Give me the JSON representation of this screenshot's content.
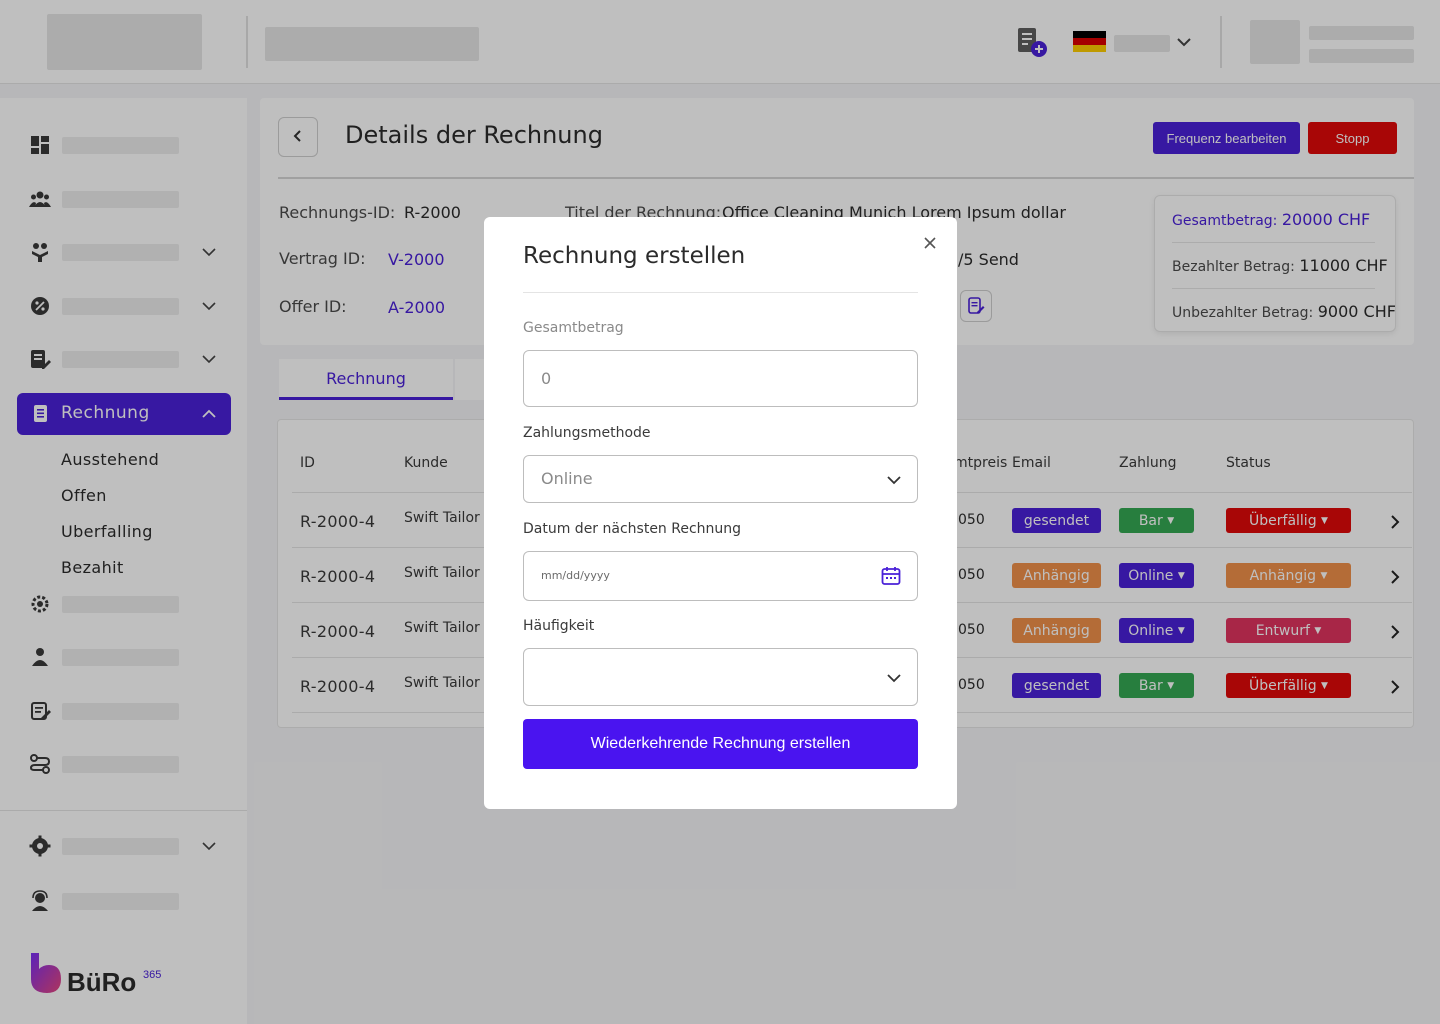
{
  "colors": {
    "accent": "#4a21d8",
    "danger": "#e10909",
    "success": "#34a853",
    "warning": "#f0914a",
    "draft": "#e0335f"
  },
  "sidebar": {
    "active_label": "Rechnung",
    "sub_items": [
      "Ausstehend",
      "Offen",
      "Uberfalling",
      "Bezahit"
    ],
    "icons": [
      "dashboard-icon",
      "users-icon",
      "handshake-icon",
      "badge-percent-icon",
      "document-edit-icon",
      "invoice-icon",
      "gear-cog-icon",
      "person-icon",
      "notes-icon",
      "route-icon",
      "settings-icon",
      "support-icon"
    ]
  },
  "logo": {
    "text": "BüRo",
    "superscript": "365"
  },
  "header": {
    "title": "Details der Rechnung",
    "edit_frequency_button": "Frequenz bearbeiten",
    "stop_button": "Stopp"
  },
  "details": {
    "invoice_id_label": "Rechnungs-ID:",
    "invoice_id": "R-2000",
    "contract_id_label": "Vertrag ID:",
    "contract_id": "V-2000",
    "offer_id_label": "Offer ID:",
    "offer_id": "A-2000",
    "invoice_title_label": "Titel der Rechnung:",
    "invoice_title": "Office Cleaning Munich Lorem Ipsum dollar",
    "send_count": "/5 Send"
  },
  "summary": {
    "total_label": "Gesamtbetrag:",
    "total": "20000 CHF",
    "paid_label": "Bezahlter Betrag:",
    "paid": "11000 CHF",
    "unpaid_label": "Unbezahlter Betrag:",
    "unpaid": "9000 CHF"
  },
  "tabs": {
    "active": "Rechnung"
  },
  "table": {
    "headers": {
      "id": "ID",
      "kunde": "Kunde",
      "price": "mtpreis",
      "email": "Email",
      "payment": "Zahlung",
      "status": "Status"
    },
    "rows": [
      {
        "id": "R-2000-4",
        "kunde": "Swift Tailor .",
        "price": "050",
        "email": "gesendet",
        "payment": "Bar",
        "status": "Überfällig"
      },
      {
        "id": "R-2000-4",
        "kunde": "Swift Tailor .",
        "price": "050",
        "email": "Anhängig",
        "payment": "Online",
        "status": "Anhängig"
      },
      {
        "id": "R-2000-4",
        "kunde": "Swift Tailor .",
        "price": "050",
        "email": "Anhängig",
        "payment": "Online",
        "status": "Entwurf"
      },
      {
        "id": "R-2000-4",
        "kunde": "Swift Tailor .",
        "price": "050",
        "email": "gesendet",
        "payment": "Bar",
        "status": "Überfällig"
      }
    ]
  },
  "modal": {
    "title": "Rechnung erstellen",
    "total_label": "Gesamtbetrag",
    "total_placeholder": "0",
    "payment_label": "Zahlungsmethode",
    "payment_value": "Online",
    "next_date_label": "Datum der nächsten Rechnung",
    "next_date_placeholder": "mm/dd/yyyy",
    "frequency_label": "Häufigkeit",
    "frequency_value": "",
    "submit": "Wiederkehrende Rechnung erstellen"
  }
}
